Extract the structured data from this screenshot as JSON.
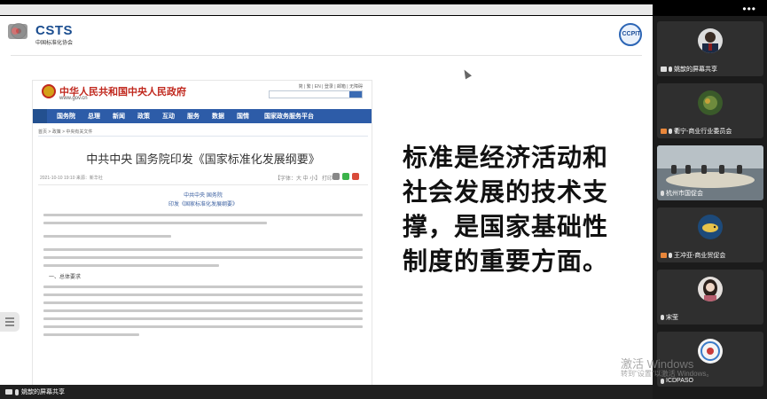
{
  "shared_slide": {
    "logo_left": {
      "name": "CSTS",
      "subtitle": "中国标准化协会"
    },
    "logo_right": {
      "name": "CCPIT"
    },
    "quote": "标准是经济活动和社会发展的技术支撑，是国家基础性制度的重要方面。",
    "gov_page": {
      "site_title": "中华人民共和国中央人民政府",
      "site_url": "www.gov.cn",
      "top_links": "简 | 繁 | EN | 登录 | 邮箱 | 无障碍",
      "nav": [
        "国务院",
        "总理",
        "新闻",
        "政策",
        "互动",
        "服务",
        "数据",
        "国情",
        "国家政务服务平台"
      ],
      "breadcrumb": "首页 > 政策 > 中央有关文件",
      "article_title": "中共中央 国务院印发《国家标准化发展纲要》",
      "article_meta": "2021-10-10 19:10 来源：新华社",
      "article_tools": "【字体：大 中 小】 打印",
      "heading_1": "中共中央 国务院",
      "heading_2": "印发《国家标准化发展纲要》",
      "section_head": "一、总体要求"
    }
  },
  "participants": [
    {
      "name": "姚歆的屏幕共享",
      "kind": "avatar-man"
    },
    {
      "name": "衢宁-商业行业委员会",
      "kind": "avatar-flower"
    },
    {
      "name": "杭州市国促会",
      "kind": "room"
    },
    {
      "name": "王冲亚-商业贸促会",
      "kind": "avatar-fish"
    },
    {
      "name": "宋莹",
      "kind": "avatar-woman"
    },
    {
      "name": "ICDPASO",
      "kind": "avatar-logo"
    }
  ],
  "bottom_label": "姚歆的屏幕共享",
  "watermark": {
    "line1": "激活 Windows",
    "line2": "转到\"设置\"以激活 Windows。"
  }
}
